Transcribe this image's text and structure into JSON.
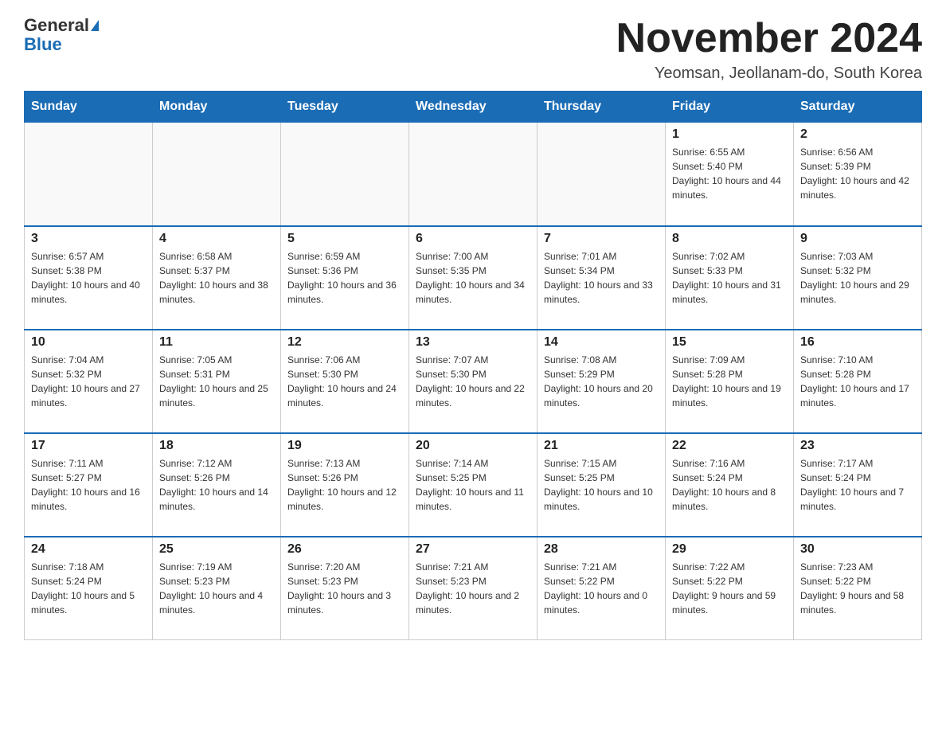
{
  "header": {
    "logo_general": "General",
    "logo_blue": "Blue",
    "month_title": "November 2024",
    "location": "Yeomsan, Jeollanam-do, South Korea"
  },
  "weekdays": [
    "Sunday",
    "Monday",
    "Tuesday",
    "Wednesday",
    "Thursday",
    "Friday",
    "Saturday"
  ],
  "weeks": [
    [
      {
        "day": "",
        "sunrise": "",
        "sunset": "",
        "daylight": ""
      },
      {
        "day": "",
        "sunrise": "",
        "sunset": "",
        "daylight": ""
      },
      {
        "day": "",
        "sunrise": "",
        "sunset": "",
        "daylight": ""
      },
      {
        "day": "",
        "sunrise": "",
        "sunset": "",
        "daylight": ""
      },
      {
        "day": "",
        "sunrise": "",
        "sunset": "",
        "daylight": ""
      },
      {
        "day": "1",
        "sunrise": "Sunrise: 6:55 AM",
        "sunset": "Sunset: 5:40 PM",
        "daylight": "Daylight: 10 hours and 44 minutes."
      },
      {
        "day": "2",
        "sunrise": "Sunrise: 6:56 AM",
        "sunset": "Sunset: 5:39 PM",
        "daylight": "Daylight: 10 hours and 42 minutes."
      }
    ],
    [
      {
        "day": "3",
        "sunrise": "Sunrise: 6:57 AM",
        "sunset": "Sunset: 5:38 PM",
        "daylight": "Daylight: 10 hours and 40 minutes."
      },
      {
        "day": "4",
        "sunrise": "Sunrise: 6:58 AM",
        "sunset": "Sunset: 5:37 PM",
        "daylight": "Daylight: 10 hours and 38 minutes."
      },
      {
        "day": "5",
        "sunrise": "Sunrise: 6:59 AM",
        "sunset": "Sunset: 5:36 PM",
        "daylight": "Daylight: 10 hours and 36 minutes."
      },
      {
        "day": "6",
        "sunrise": "Sunrise: 7:00 AM",
        "sunset": "Sunset: 5:35 PM",
        "daylight": "Daylight: 10 hours and 34 minutes."
      },
      {
        "day": "7",
        "sunrise": "Sunrise: 7:01 AM",
        "sunset": "Sunset: 5:34 PM",
        "daylight": "Daylight: 10 hours and 33 minutes."
      },
      {
        "day": "8",
        "sunrise": "Sunrise: 7:02 AM",
        "sunset": "Sunset: 5:33 PM",
        "daylight": "Daylight: 10 hours and 31 minutes."
      },
      {
        "day": "9",
        "sunrise": "Sunrise: 7:03 AM",
        "sunset": "Sunset: 5:32 PM",
        "daylight": "Daylight: 10 hours and 29 minutes."
      }
    ],
    [
      {
        "day": "10",
        "sunrise": "Sunrise: 7:04 AM",
        "sunset": "Sunset: 5:32 PM",
        "daylight": "Daylight: 10 hours and 27 minutes."
      },
      {
        "day": "11",
        "sunrise": "Sunrise: 7:05 AM",
        "sunset": "Sunset: 5:31 PM",
        "daylight": "Daylight: 10 hours and 25 minutes."
      },
      {
        "day": "12",
        "sunrise": "Sunrise: 7:06 AM",
        "sunset": "Sunset: 5:30 PM",
        "daylight": "Daylight: 10 hours and 24 minutes."
      },
      {
        "day": "13",
        "sunrise": "Sunrise: 7:07 AM",
        "sunset": "Sunset: 5:30 PM",
        "daylight": "Daylight: 10 hours and 22 minutes."
      },
      {
        "day": "14",
        "sunrise": "Sunrise: 7:08 AM",
        "sunset": "Sunset: 5:29 PM",
        "daylight": "Daylight: 10 hours and 20 minutes."
      },
      {
        "day": "15",
        "sunrise": "Sunrise: 7:09 AM",
        "sunset": "Sunset: 5:28 PM",
        "daylight": "Daylight: 10 hours and 19 minutes."
      },
      {
        "day": "16",
        "sunrise": "Sunrise: 7:10 AM",
        "sunset": "Sunset: 5:28 PM",
        "daylight": "Daylight: 10 hours and 17 minutes."
      }
    ],
    [
      {
        "day": "17",
        "sunrise": "Sunrise: 7:11 AM",
        "sunset": "Sunset: 5:27 PM",
        "daylight": "Daylight: 10 hours and 16 minutes."
      },
      {
        "day": "18",
        "sunrise": "Sunrise: 7:12 AM",
        "sunset": "Sunset: 5:26 PM",
        "daylight": "Daylight: 10 hours and 14 minutes."
      },
      {
        "day": "19",
        "sunrise": "Sunrise: 7:13 AM",
        "sunset": "Sunset: 5:26 PM",
        "daylight": "Daylight: 10 hours and 12 minutes."
      },
      {
        "day": "20",
        "sunrise": "Sunrise: 7:14 AM",
        "sunset": "Sunset: 5:25 PM",
        "daylight": "Daylight: 10 hours and 11 minutes."
      },
      {
        "day": "21",
        "sunrise": "Sunrise: 7:15 AM",
        "sunset": "Sunset: 5:25 PM",
        "daylight": "Daylight: 10 hours and 10 minutes."
      },
      {
        "day": "22",
        "sunrise": "Sunrise: 7:16 AM",
        "sunset": "Sunset: 5:24 PM",
        "daylight": "Daylight: 10 hours and 8 minutes."
      },
      {
        "day": "23",
        "sunrise": "Sunrise: 7:17 AM",
        "sunset": "Sunset: 5:24 PM",
        "daylight": "Daylight: 10 hours and 7 minutes."
      }
    ],
    [
      {
        "day": "24",
        "sunrise": "Sunrise: 7:18 AM",
        "sunset": "Sunset: 5:24 PM",
        "daylight": "Daylight: 10 hours and 5 minutes."
      },
      {
        "day": "25",
        "sunrise": "Sunrise: 7:19 AM",
        "sunset": "Sunset: 5:23 PM",
        "daylight": "Daylight: 10 hours and 4 minutes."
      },
      {
        "day": "26",
        "sunrise": "Sunrise: 7:20 AM",
        "sunset": "Sunset: 5:23 PM",
        "daylight": "Daylight: 10 hours and 3 minutes."
      },
      {
        "day": "27",
        "sunrise": "Sunrise: 7:21 AM",
        "sunset": "Sunset: 5:23 PM",
        "daylight": "Daylight: 10 hours and 2 minutes."
      },
      {
        "day": "28",
        "sunrise": "Sunrise: 7:21 AM",
        "sunset": "Sunset: 5:22 PM",
        "daylight": "Daylight: 10 hours and 0 minutes."
      },
      {
        "day": "29",
        "sunrise": "Sunrise: 7:22 AM",
        "sunset": "Sunset: 5:22 PM",
        "daylight": "Daylight: 9 hours and 59 minutes."
      },
      {
        "day": "30",
        "sunrise": "Sunrise: 7:23 AM",
        "sunset": "Sunset: 5:22 PM",
        "daylight": "Daylight: 9 hours and 58 minutes."
      }
    ]
  ]
}
